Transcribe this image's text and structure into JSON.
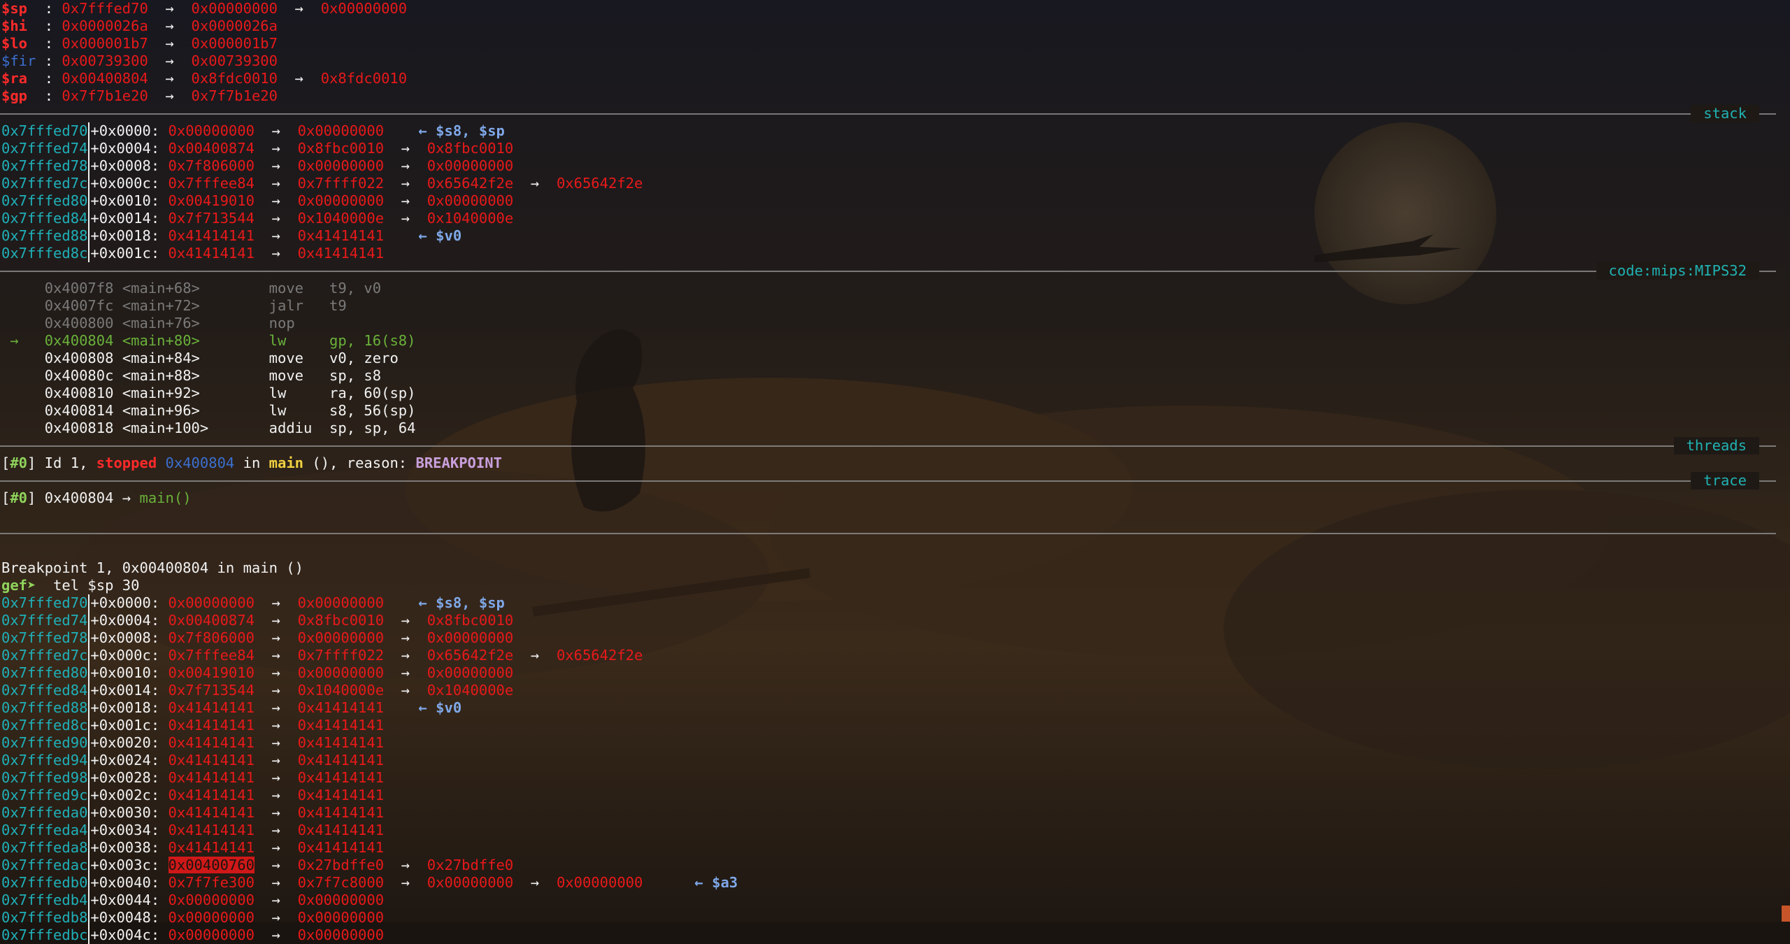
{
  "registers": [
    {
      "name": "$sp",
      "color": "red",
      "chain": [
        "0x7fffed70",
        "0x00000000",
        "0x00000000"
      ]
    },
    {
      "name": "$hi",
      "color": "red",
      "chain": [
        "0x0000026a",
        "0x0000026a"
      ]
    },
    {
      "name": "$lo",
      "color": "red",
      "chain": [
        "0x000001b7",
        "0x000001b7"
      ]
    },
    {
      "name": "$fir",
      "color": "blue",
      "chain": [
        "0x00739300",
        "0x00739300"
      ]
    },
    {
      "name": "$ra",
      "color": "red",
      "chain": [
        "0x00400804",
        "0x8fdc0010",
        "0x8fdc0010"
      ]
    },
    {
      "name": "$gp",
      "color": "red",
      "chain": [
        "0x7f7b1e20",
        "0x7f7b1e20"
      ]
    }
  ],
  "sections": {
    "stack": "stack",
    "code": "code:mips:MIPS32",
    "threads": "threads",
    "trace": "trace"
  },
  "arrow": "→",
  "back_arrow": "←",
  "stack_rows": [
    {
      "addr": "0x7fffed70",
      "off": "+0x0000:",
      "chain": [
        "0x00000000",
        "0x00000000"
      ],
      "note": "$s8, $sp"
    },
    {
      "addr": "0x7fffed74",
      "off": "+0x0004:",
      "chain": [
        "0x00400874",
        "0x8fbc0010",
        "0x8fbc0010"
      ],
      "note": ""
    },
    {
      "addr": "0x7fffed78",
      "off": "+0x0008:",
      "chain": [
        "0x7f806000",
        "0x00000000",
        "0x00000000"
      ],
      "note": ""
    },
    {
      "addr": "0x7fffed7c",
      "off": "+0x000c:",
      "chain": [
        "0x7fffee84",
        "0x7ffff022",
        "0x65642f2e",
        "0x65642f2e"
      ],
      "note": ""
    },
    {
      "addr": "0x7fffed80",
      "off": "+0x0010:",
      "chain": [
        "0x00419010",
        "0x00000000",
        "0x00000000"
      ],
      "note": ""
    },
    {
      "addr": "0x7fffed84",
      "off": "+0x0014:",
      "chain": [
        "0x7f713544",
        "0x1040000e",
        "0x1040000e"
      ],
      "note": ""
    },
    {
      "addr": "0x7fffed88",
      "off": "+0x0018:",
      "chain": [
        "0x41414141",
        "0x41414141"
      ],
      "note": "$v0"
    },
    {
      "addr": "0x7fffed8c",
      "off": "+0x001c:",
      "chain": [
        "0x41414141",
        "0x41414141"
      ],
      "note": ""
    }
  ],
  "code_rows": [
    {
      "marker": "",
      "addr": "0x4007f8",
      "sym": "<main+68>",
      "op": "move",
      "args": "t9, v0",
      "state": "past"
    },
    {
      "marker": "",
      "addr": "0x4007fc",
      "sym": "<main+72>",
      "op": "jalr",
      "args": "t9",
      "state": "past"
    },
    {
      "marker": "",
      "addr": "0x400800",
      "sym": "<main+76>",
      "op": "nop",
      "args": "",
      "state": "past"
    },
    {
      "marker": "→",
      "addr": "0x400804",
      "sym": "<main+80>",
      "op": "lw",
      "args": "gp, 16(s8)",
      "state": "current"
    },
    {
      "marker": "",
      "addr": "0x400808",
      "sym": "<main+84>",
      "op": "move",
      "args": "v0, zero",
      "state": "next"
    },
    {
      "marker": "",
      "addr": "0x40080c",
      "sym": "<main+88>",
      "op": "move",
      "args": "sp, s8",
      "state": "next"
    },
    {
      "marker": "",
      "addr": "0x400810",
      "sym": "<main+92>",
      "op": "lw",
      "args": "ra, 60(sp)",
      "state": "next"
    },
    {
      "marker": "",
      "addr": "0x400814",
      "sym": "<main+96>",
      "op": "lw",
      "args": "s8, 56(sp)",
      "state": "next"
    },
    {
      "marker": "",
      "addr": "0x400818",
      "sym": "<main+100>",
      "op": "addiu",
      "args": "sp, sp, 64",
      "state": "next"
    }
  ],
  "thread_line": {
    "idx": "[#0]",
    "id": "Id 1,",
    "status": "stopped",
    "addr": "0x400804",
    "in": "in",
    "func": "main",
    "args": "(),",
    "reason_label": "reason:",
    "reason": "BREAKPOINT"
  },
  "trace_line": {
    "idx": "[#0]",
    "addr": "0x400804",
    "arrow": "→",
    "func": "main()"
  },
  "breakpoint_msg": "Breakpoint 1, 0x00400804 in main ()",
  "prompt": "gef➤",
  "command": "tel $sp 30",
  "tel_rows": [
    {
      "addr": "0x7fffed70",
      "off": "+0x0000:",
      "chain": [
        "0x00000000",
        "0x00000000"
      ],
      "note": "$s8, $sp"
    },
    {
      "addr": "0x7fffed74",
      "off": "+0x0004:",
      "chain": [
        "0x00400874",
        "0x8fbc0010",
        "0x8fbc0010"
      ],
      "note": ""
    },
    {
      "addr": "0x7fffed78",
      "off": "+0x0008:",
      "chain": [
        "0x7f806000",
        "0x00000000",
        "0x00000000"
      ],
      "note": ""
    },
    {
      "addr": "0x7fffed7c",
      "off": "+0x000c:",
      "chain": [
        "0x7fffee84",
        "0x7ffff022",
        "0x65642f2e",
        "0x65642f2e"
      ],
      "note": ""
    },
    {
      "addr": "0x7fffed80",
      "off": "+0x0010:",
      "chain": [
        "0x00419010",
        "0x00000000",
        "0x00000000"
      ],
      "note": ""
    },
    {
      "addr": "0x7fffed84",
      "off": "+0x0014:",
      "chain": [
        "0x7f713544",
        "0x1040000e",
        "0x1040000e"
      ],
      "note": ""
    },
    {
      "addr": "0x7fffed88",
      "off": "+0x0018:",
      "chain": [
        "0x41414141",
        "0x41414141"
      ],
      "note": "$v0"
    },
    {
      "addr": "0x7fffed8c",
      "off": "+0x001c:",
      "chain": [
        "0x41414141",
        "0x41414141"
      ],
      "note": ""
    },
    {
      "addr": "0x7fffed90",
      "off": "+0x0020:",
      "chain": [
        "0x41414141",
        "0x41414141"
      ],
      "note": ""
    },
    {
      "addr": "0x7fffed94",
      "off": "+0x0024:",
      "chain": [
        "0x41414141",
        "0x41414141"
      ],
      "note": ""
    },
    {
      "addr": "0x7fffed98",
      "off": "+0x0028:",
      "chain": [
        "0x41414141",
        "0x41414141"
      ],
      "note": ""
    },
    {
      "addr": "0x7fffed9c",
      "off": "+0x002c:",
      "chain": [
        "0x41414141",
        "0x41414141"
      ],
      "note": ""
    },
    {
      "addr": "0x7fffeda0",
      "off": "+0x0030:",
      "chain": [
        "0x41414141",
        "0x41414141"
      ],
      "note": ""
    },
    {
      "addr": "0x7fffeda4",
      "off": "+0x0034:",
      "chain": [
        "0x41414141",
        "0x41414141"
      ],
      "note": ""
    },
    {
      "addr": "0x7fffeda8",
      "off": "+0x0038:",
      "chain": [
        "0x41414141",
        "0x41414141"
      ],
      "note": ""
    },
    {
      "addr": "0x7fffedac",
      "off": "+0x003c:",
      "chain": [
        "0x00400760",
        "0x27bdffe0",
        "0x27bdffe0"
      ],
      "note": "",
      "highlight": true
    },
    {
      "addr": "0x7fffedb0",
      "off": "+0x0040:",
      "chain": [
        "0x7f7fe300",
        "0x7f7c8000",
        "0x00000000",
        "0x00000000"
      ],
      "note": "$a3"
    },
    {
      "addr": "0x7fffedb4",
      "off": "+0x0044:",
      "chain": [
        "0x00000000",
        "0x00000000"
      ],
      "note": ""
    },
    {
      "addr": "0x7fffedb8",
      "off": "+0x0048:",
      "chain": [
        "0x00000000",
        "0x00000000"
      ],
      "note": ""
    },
    {
      "addr": "0x7fffedbc",
      "off": "+0x004c:",
      "chain": [
        "0x00000000",
        "0x00000000"
      ],
      "note": ""
    }
  ],
  "colors": {
    "background": "#1a1410",
    "value_red": "#e8191a",
    "address_cyan": "#1fb0b8",
    "section_title": "#20b2b2",
    "current_green": "#6ab13a"
  }
}
